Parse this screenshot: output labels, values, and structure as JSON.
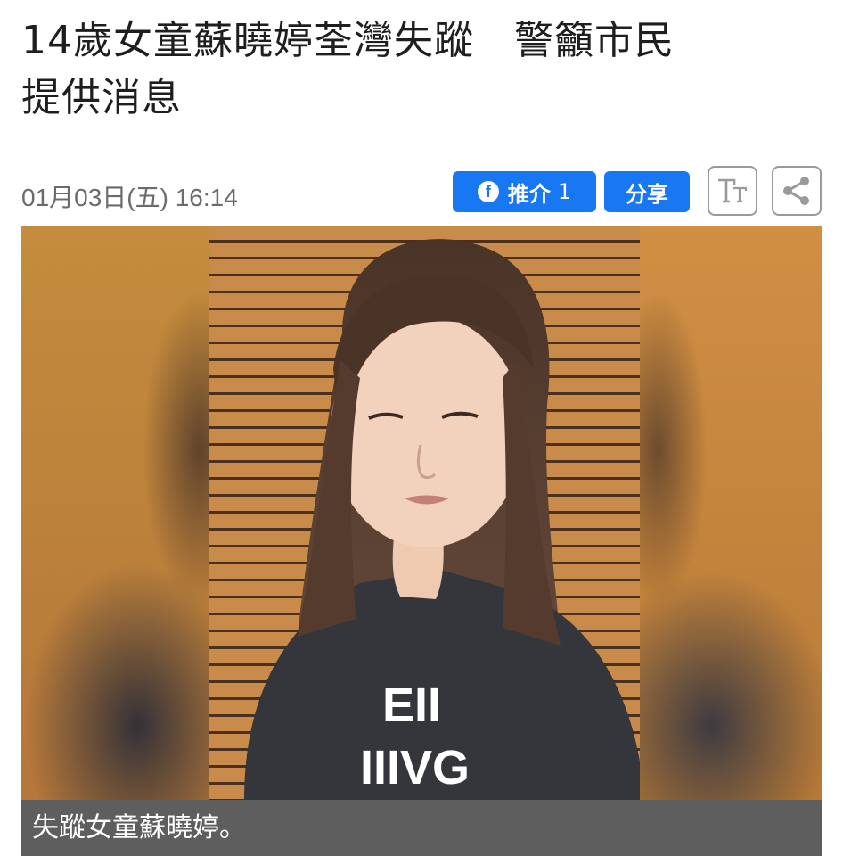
{
  "article": {
    "title_line1": "14歲女童蘇曉婷荃灣失蹤　警籲市民",
    "title_line2": "提供消息",
    "date": "01月03日(五) 16:14",
    "photo_caption": "失蹤女童蘇曉婷。",
    "shirt_text_line1": "EII",
    "shirt_text_line2": "IIIVG"
  },
  "toolbar": {
    "fb_icon_glyph": "f",
    "like_label": "推介",
    "like_count": "1",
    "share_label": "分享",
    "font_size_icon": "font-size-icon",
    "share_icon": "share-icon"
  },
  "colors": {
    "facebook_blue": "#1877f2",
    "caption_bg": "#5e5e5e",
    "date_gray": "#6b6b6b"
  }
}
